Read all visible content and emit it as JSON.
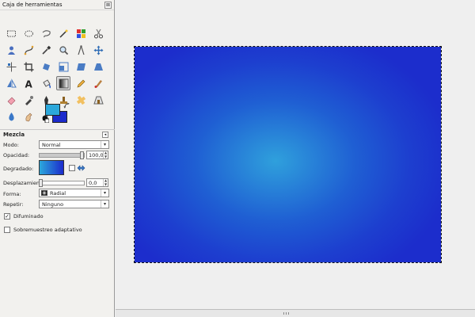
{
  "toolbox": {
    "title": "Caja de herramientas",
    "close_glyph": "⊠",
    "tools": [
      {
        "name": "rect-select",
        "icon": "rect-select-icon"
      },
      {
        "name": "ellipse-select",
        "icon": "ellipse-select-icon"
      },
      {
        "name": "free-select",
        "icon": "lasso-icon"
      },
      {
        "name": "fuzzy-select",
        "icon": "magic-wand-icon"
      },
      {
        "name": "select-by-color",
        "icon": "select-by-color-icon"
      },
      {
        "name": "scissors-select",
        "icon": "scissors-icon"
      },
      {
        "name": "foreground-select",
        "icon": "foreground-select-icon"
      },
      {
        "name": "paths",
        "icon": "paths-icon"
      },
      {
        "name": "color-picker",
        "icon": "eyedropper-icon"
      },
      {
        "name": "zoom",
        "icon": "magnifier-icon"
      },
      {
        "name": "measure",
        "icon": "compass-icon"
      },
      {
        "name": "move",
        "icon": "move-icon"
      },
      {
        "name": "align",
        "icon": "align-icon"
      },
      {
        "name": "crop",
        "icon": "crop-icon"
      },
      {
        "name": "rotate",
        "icon": "rotate-icon"
      },
      {
        "name": "scale",
        "icon": "scale-icon"
      },
      {
        "name": "shear",
        "icon": "shear-icon"
      },
      {
        "name": "perspective",
        "icon": "perspective-icon"
      },
      {
        "name": "flip",
        "icon": "flip-icon"
      },
      {
        "name": "text",
        "icon": "text-icon"
      },
      {
        "name": "bucket-fill",
        "icon": "bucket-fill-icon"
      },
      {
        "name": "blend",
        "icon": "gradient-icon"
      },
      {
        "name": "pencil",
        "icon": "pencil-icon"
      },
      {
        "name": "paintbrush",
        "icon": "paintbrush-icon"
      },
      {
        "name": "eraser",
        "icon": "eraser-icon"
      },
      {
        "name": "airbrush",
        "icon": "airbrush-icon"
      },
      {
        "name": "ink",
        "icon": "ink-icon"
      },
      {
        "name": "clone",
        "icon": "clone-stamp-icon"
      },
      {
        "name": "heal",
        "icon": "heal-icon"
      },
      {
        "name": "perspective-clone",
        "icon": "perspective-clone-icon"
      },
      {
        "name": "blur-sharpen",
        "icon": "blur-icon"
      },
      {
        "name": "smudge",
        "icon": "smudge-icon"
      },
      {
        "name": "dodge-burn",
        "icon": "dodge-burn-icon"
      }
    ],
    "active_tool": "blend",
    "colors": {
      "foreground": "#2ca8db",
      "background": "#1c2bcc"
    }
  },
  "options": {
    "header": "Mezcla",
    "mode_label": "Modo:",
    "mode_value": "Normal",
    "opacity_label": "Opacidad:",
    "opacity_value": "100,0",
    "opacity_fraction": 1.0,
    "gradient_label": "Degradado:",
    "offset_label": "Desplazamiento:",
    "offset_value": "0,0",
    "offset_fraction": 0.0,
    "shape_label": "Forma:",
    "shape_value": "Radial",
    "repeat_label": "Repetir:",
    "repeat_value": "Ninguno",
    "dither_label": "Difuminado",
    "dither_checked": true,
    "adaptive_label": "Sobremuestreo adaptativo",
    "adaptive_checked": false
  },
  "canvas": {
    "gradient_center_color": "#2fa0dc",
    "gradient_edge_color": "#1c2dcc"
  }
}
